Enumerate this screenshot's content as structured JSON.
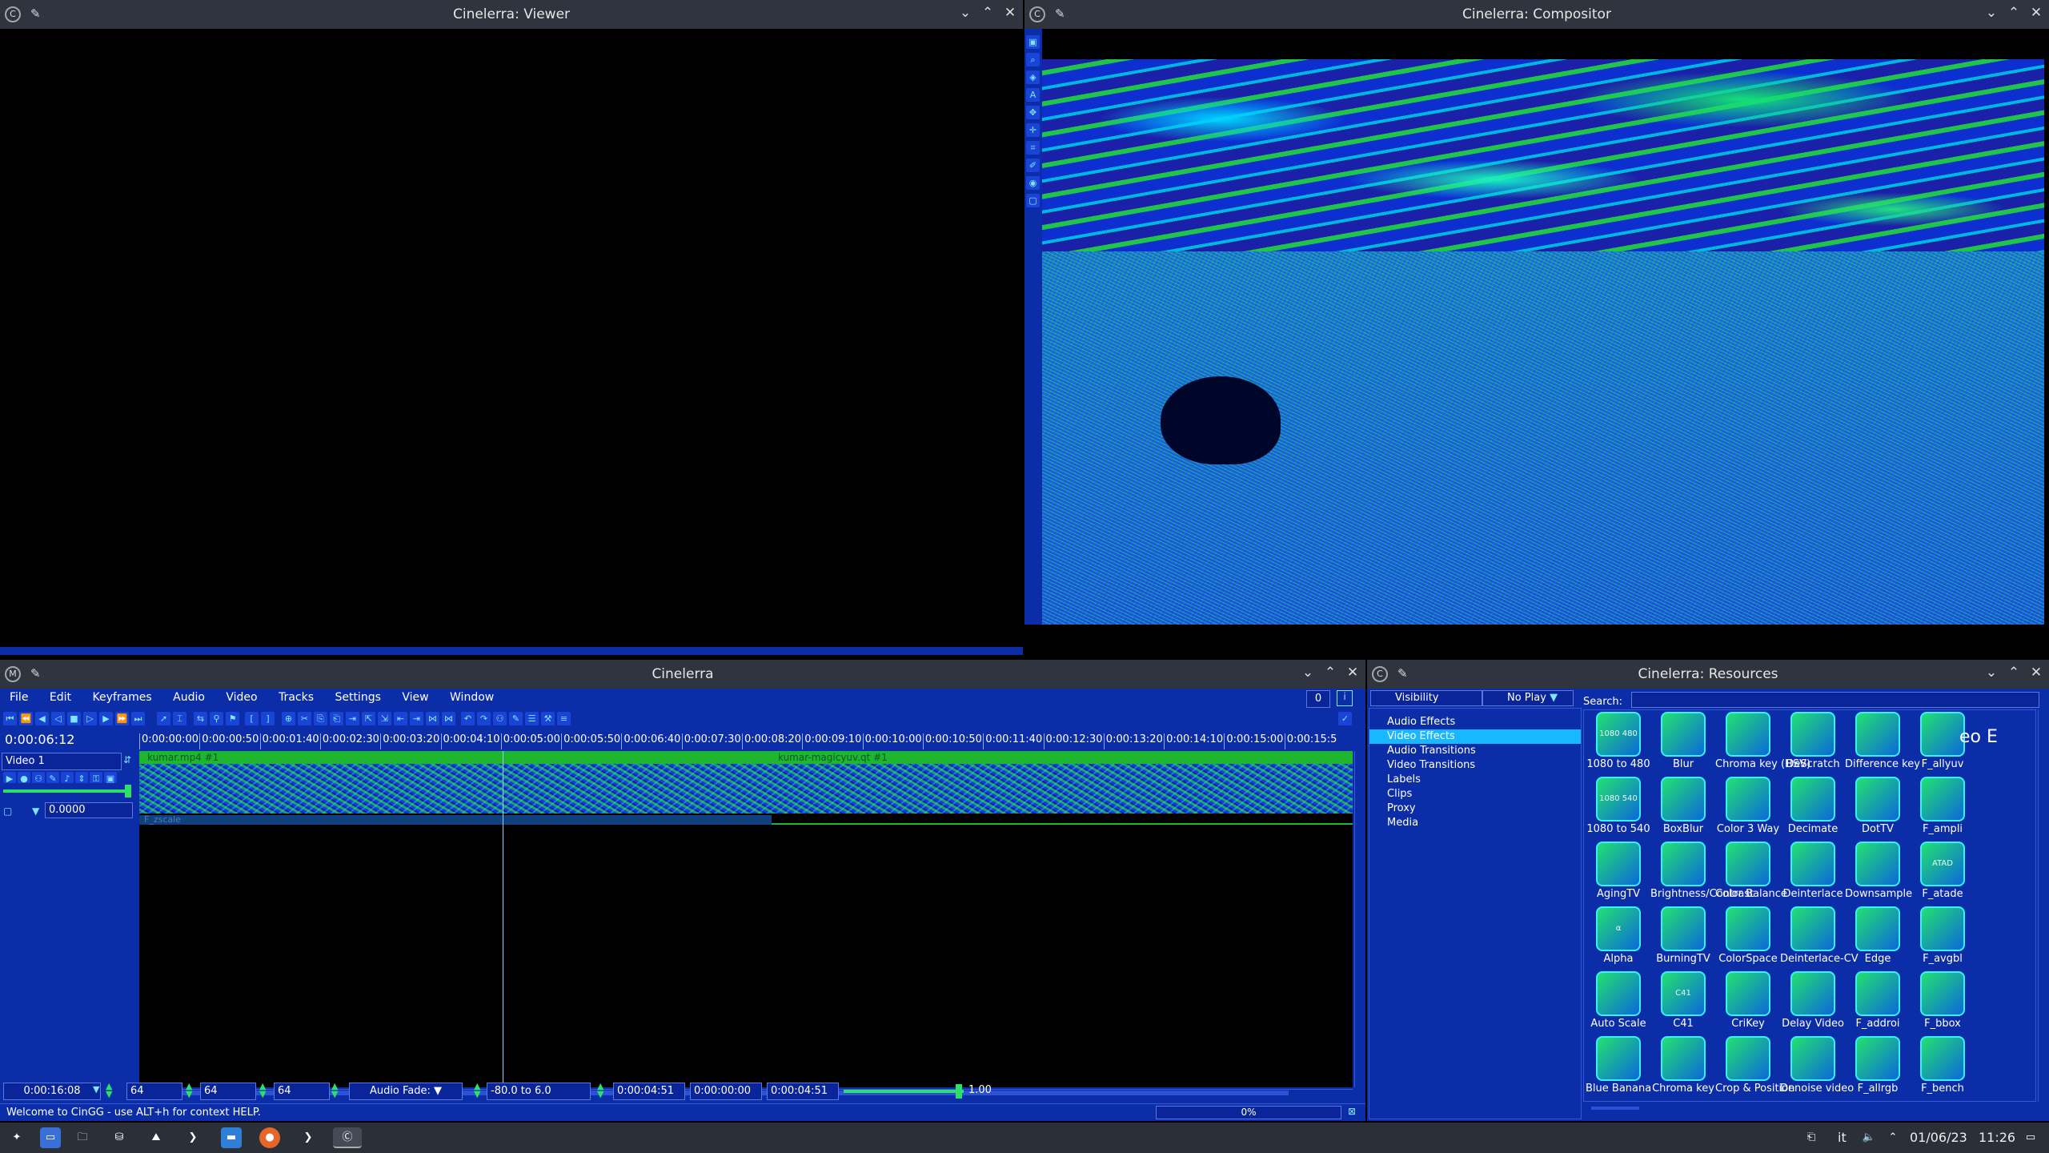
{
  "viewer": {
    "title": "Cinelerra: Viewer"
  },
  "compositor": {
    "title": "Cinelerra: Compositor"
  },
  "main": {
    "title": "Cinelerra",
    "menu": [
      "File",
      "Edit",
      "Keyframes",
      "Audio",
      "Video",
      "Tracks",
      "Settings",
      "View",
      "Window"
    ],
    "counter": "0",
    "time": "0:00:06:12",
    "ruler": [
      "0:00:00:00",
      "0:00:00:50",
      "0:00:01:40",
      "0:00:02:30",
      "0:00:03:20",
      "0:00:04:10",
      "0:00:05:00",
      "0:00:05:50",
      "0:00:06:40",
      "0:00:07:30",
      "0:00:08:20",
      "0:00:09:10",
      "0:00:10:00",
      "0:00:10:50",
      "0:00:11:40",
      "0:00:12:30",
      "0:00:13:20",
      "0:00:14:10",
      "0:00:15:00",
      "0:00:15:5"
    ],
    "track_name": "Video 1",
    "track_value": "0.0000",
    "clip1": "kumar.mp4 #1",
    "clip2": "kumar-magicyuv.qt #1",
    "effect": "F_zscale",
    "bottom": {
      "total": "0:00:16:08",
      "z1": "64",
      "z2": "64",
      "z3": "64",
      "fade_label": "Audio Fade:",
      "fade_range": "-80.0 to 6.0",
      "t1": "0:00:04:51",
      "t2": "0:00:00:00",
      "t3": "0:00:04:51",
      "slider_val": "1.00",
      "slider_level": 0.96
    },
    "status": "Welcome to CinGG - use ALT+h for context HELP.",
    "progress": "0%"
  },
  "resources": {
    "title": "Cinelerra: Resources",
    "visibility": "Visibility",
    "noplay": "No Play",
    "search_label": "Search:",
    "folders": [
      "Audio Effects",
      "Video Effects",
      "Audio Transitions",
      "Video Transitions",
      "Labels",
      "Clips",
      "Proxy",
      "Media"
    ],
    "selected": 1,
    "overlay_text": "eo E",
    "effects": [
      {
        "label": "1080 to 480",
        "icon": "1080 480"
      },
      {
        "label": "Blur",
        "icon": ""
      },
      {
        "label": "Chroma key (HSV)",
        "icon": ""
      },
      {
        "label": "DeScratch",
        "icon": ""
      },
      {
        "label": "Difference key",
        "icon": ""
      },
      {
        "label": "F_allyuv",
        "icon": ""
      },
      {
        "label": "1080 to 540",
        "icon": "1080 540"
      },
      {
        "label": "BoxBlur",
        "icon": ""
      },
      {
        "label": "Color 3 Way",
        "icon": ""
      },
      {
        "label": "Decimate",
        "icon": ""
      },
      {
        "label": "DotTV",
        "icon": ""
      },
      {
        "label": "F_ampli",
        "icon": ""
      },
      {
        "label": "AgingTV",
        "icon": ""
      },
      {
        "label": "Brightness/Contrast",
        "icon": ""
      },
      {
        "label": "Color Balance",
        "icon": ""
      },
      {
        "label": "Deinterlace",
        "icon": ""
      },
      {
        "label": "Downsample",
        "icon": ""
      },
      {
        "label": "F_atade",
        "icon": "ATAD"
      },
      {
        "label": "Alpha",
        "icon": "α"
      },
      {
        "label": "BurningTV",
        "icon": ""
      },
      {
        "label": "ColorSpace",
        "icon": ""
      },
      {
        "label": "Deinterlace-CV",
        "icon": ""
      },
      {
        "label": "Edge",
        "icon": ""
      },
      {
        "label": "F_avgbl",
        "icon": ""
      },
      {
        "label": "Auto Scale",
        "icon": ""
      },
      {
        "label": "C41",
        "icon": "C41"
      },
      {
        "label": "CriKey",
        "icon": ""
      },
      {
        "label": "Delay Video",
        "icon": ""
      },
      {
        "label": "F_addroi",
        "icon": ""
      },
      {
        "label": "F_bbox",
        "icon": ""
      },
      {
        "label": "Blue Banana",
        "icon": ""
      },
      {
        "label": "Chroma key",
        "icon": ""
      },
      {
        "label": "Crop & Position",
        "icon": ""
      },
      {
        "label": "Denoise video",
        "icon": ""
      },
      {
        "label": "F_allrgb",
        "icon": ""
      },
      {
        "label": "F_bench",
        "icon": ""
      }
    ]
  },
  "taskbar": {
    "lang": "it",
    "date": "01/06/23",
    "time": "11:26"
  },
  "colors": {
    "panel": "#0c2da8",
    "titlebar": "#2f343f",
    "accent": "#17b8ff",
    "track": "#1eb530"
  }
}
